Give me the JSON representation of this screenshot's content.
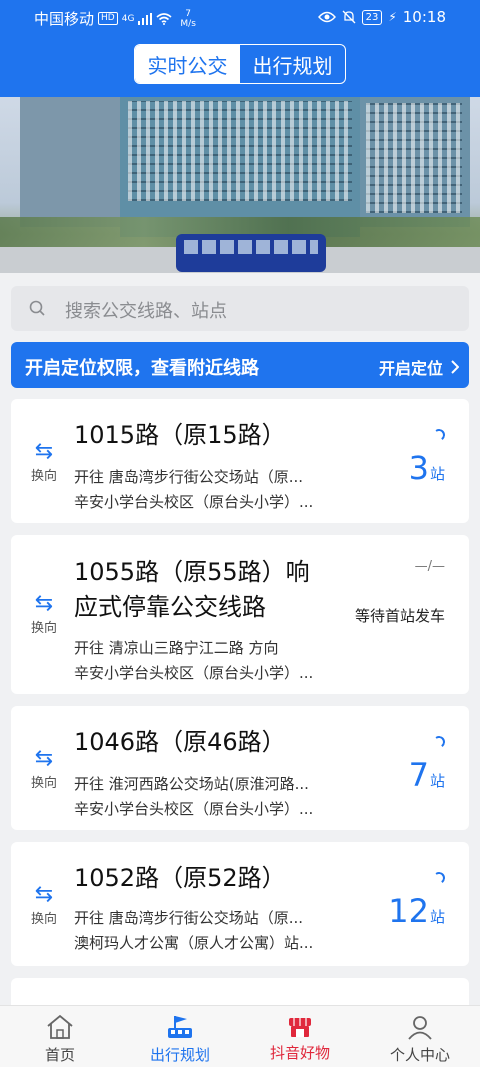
{
  "status_bar": {
    "carrier": "中国移动",
    "hd": "HD",
    "signal_tag": "4G",
    "speed_value": "7",
    "speed_unit": "M/s",
    "battery": "23",
    "time": "10:18"
  },
  "header": {
    "tabs": [
      {
        "label": "实时公交",
        "active": true
      },
      {
        "label": "出行规划",
        "active": false
      }
    ]
  },
  "search": {
    "placeholder": "搜索公交线路、站点"
  },
  "location_bar": {
    "message": "开启定位权限，查看附近线路",
    "button_label": "开启定位"
  },
  "routes": [
    {
      "swap_label": "换向",
      "name": "1015路（原15路）",
      "direction_line1": "开往 唐岛湾步行街公交场站（原...",
      "direction_line2": "辛安小学台头校区（原台头小学）...",
      "eta_value": "3",
      "eta_unit": "站"
    },
    {
      "swap_label": "换向",
      "name_line1": "1055路（原55路）响",
      "name_line2": "应式停靠公交线路",
      "direction_line1": "开往 清凉山三路宁江二路 方向",
      "direction_line2": "辛安小学台头校区（原台头小学）...",
      "wait_dash": "—/—",
      "wait_text": "等待首站发车"
    },
    {
      "swap_label": "换向",
      "name": "1046路（原46路）",
      "direction_line1": "开往 淮河西路公交场站(原淮河路...",
      "direction_line2": "辛安小学台头校区（原台头小学）...",
      "eta_value": "7",
      "eta_unit": "站"
    },
    {
      "swap_label": "换向",
      "name": "1052路（原52路）",
      "direction_line1": "开往 唐岛湾步行街公交场站（原...",
      "direction_line2": "澳柯玛人才公寓（原人才公寓）站...",
      "eta_value": "12",
      "eta_unit": "站"
    }
  ],
  "tab_bar": {
    "items": [
      {
        "label": "首页",
        "icon": "home-icon",
        "color": "#444444"
      },
      {
        "label": "出行规划",
        "icon": "bus-flag-icon",
        "color": "#1f74ee"
      },
      {
        "label": "抖音好物",
        "icon": "shop-icon",
        "color": "#e0283c"
      },
      {
        "label": "个人中心",
        "icon": "person-icon",
        "color": "#444444"
      }
    ]
  },
  "colors": {
    "primary": "#1f74ee",
    "accent_red": "#e0283c",
    "background": "#f0f1f3"
  }
}
